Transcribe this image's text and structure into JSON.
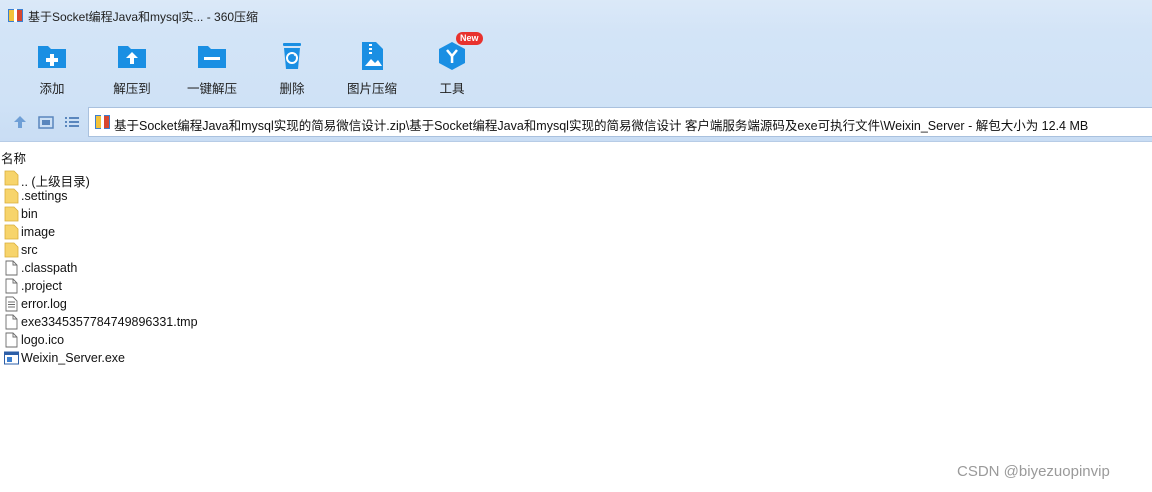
{
  "window": {
    "title": "基于Socket编程Java和mysql实... - 360压缩",
    "app_icon": "archive-icon"
  },
  "toolbar": {
    "items": [
      {
        "label": "添加",
        "icon": "add-folder-icon",
        "color": "#1a8fe3"
      },
      {
        "label": "解压到",
        "icon": "extract-to-folder-icon",
        "color": "#1a8fe3"
      },
      {
        "label": "一键解压",
        "icon": "one-click-extract-icon",
        "color": "#1a8fe3"
      },
      {
        "label": "删除",
        "icon": "recycle-bin-icon",
        "color": "#1a8fe3"
      },
      {
        "label": "图片压缩",
        "icon": "image-compress-icon",
        "color": "#1a8fe3"
      },
      {
        "label": "工具",
        "icon": "tools-cube-icon",
        "color": "#1a8fe3",
        "badge": "New"
      }
    ]
  },
  "nav": {
    "up": "up-arrow-icon",
    "view_thumbnail": "thumbnail-view-icon",
    "view_list": "list-view-icon",
    "path": "基于Socket编程Java和mysql实现的简易微信设计.zip\\基于Socket编程Java和mysql实现的简易微信设计 客户端服务端源码及exe可执行文件\\Weixin_Server - 解包大小为 12.4 MB"
  },
  "columns": {
    "name": "名称"
  },
  "files": [
    {
      "name": ".. (上级目录)",
      "type": "folder"
    },
    {
      "name": ".settings",
      "type": "folder"
    },
    {
      "name": "bin",
      "type": "folder"
    },
    {
      "name": "image",
      "type": "folder"
    },
    {
      "name": "src",
      "type": "folder"
    },
    {
      "name": ".classpath",
      "type": "file"
    },
    {
      "name": ".project",
      "type": "file"
    },
    {
      "name": "error.log",
      "type": "text"
    },
    {
      "name": "exe3345357784749896331.tmp",
      "type": "file"
    },
    {
      "name": "logo.ico",
      "type": "file"
    },
    {
      "name": "Weixin_Server.exe",
      "type": "exe"
    }
  ],
  "watermark": "CSDN @biyezuopinvip",
  "colors": {
    "accent": "#1a8fe3",
    "folder": "#f7d46b",
    "badge": "#e8322e"
  }
}
